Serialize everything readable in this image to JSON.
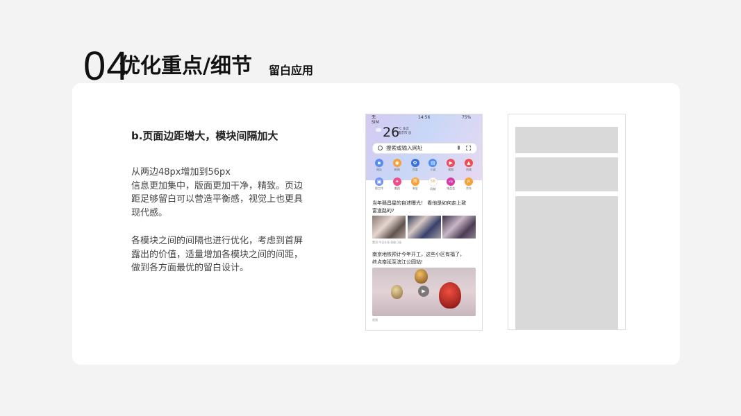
{
  "slide": {
    "number": "04",
    "title": "优化重点/细节",
    "subtitle": "留白应用"
  },
  "content": {
    "heading": "b.页面边距增大，模块间隔加大",
    "para1": [
      "从两边48px增加到56px",
      "信息更加集中，版面更加干净，精致。页边",
      "距足够留白可以营造平衡感，视觉上也更具",
      "现代感。"
    ],
    "para2": [
      "各模块之间的间隔也进行优化，考虑到首屏",
      "露出的价值，适量增加各模块之间的间距，",
      "做到各方面最优的留白设计。"
    ]
  },
  "phone": {
    "status_left": "无\nSIM",
    "status_time": "14:56",
    "status_battery": "75%",
    "temperature": "26",
    "weather_line1": "°C 多云",
    "weather_line2": "南京市 良",
    "search_placeholder": "搜索或输入网址",
    "apps_row1": [
      {
        "label": "网址",
        "color": "#5b8df0",
        "icon": "bookmark-icon"
      },
      {
        "label": "新闻",
        "color": "#f4a03a",
        "icon": "eye-icon"
      },
      {
        "label": "百度",
        "color": "#3a6fe0",
        "icon": "paw-icon"
      },
      {
        "label": "小说",
        "color": "#4e8ff2",
        "icon": "book-icon"
      },
      {
        "label": "视频",
        "color": "#ef4b5a",
        "icon": "play-icon"
      },
      {
        "label": "热搜",
        "color": "#f04e4e",
        "icon": "fire-icon"
      }
    ],
    "apps_row2": [
      {
        "label": "找工作",
        "color": "#6f93ef",
        "icon": "briefcase-icon"
      },
      {
        "label": "美团",
        "color": "#f04b8a",
        "icon": "meituan-icon"
      },
      {
        "label": "淘宝",
        "color": "#f6a23c",
        "icon": "taobao-icon",
        "glyph": "淘"
      },
      {
        "label": "同城",
        "color": "#ffffff",
        "icon": "58-icon",
        "glyph": "58"
      },
      {
        "label": "唯品会",
        "color": "#d63aa7",
        "icon": "vip-icon"
      },
      {
        "label": "京东",
        "color": "#f5a23b",
        "icon": "jd-icon"
      }
    ],
    "news1_title": [
      "当年赣昌星的自述曝光！ 看他是如何走上致",
      "富道路的?"
    ],
    "news1_meta": "置顶   今日头条   刚刚   1条",
    "news2_title": [
      "南京地铁预计今年开工，这些小区有福了，",
      "终点南延至滨江公园站!"
    ],
    "news2_meta": "视频"
  },
  "wireframe": {
    "blocks": 3
  }
}
